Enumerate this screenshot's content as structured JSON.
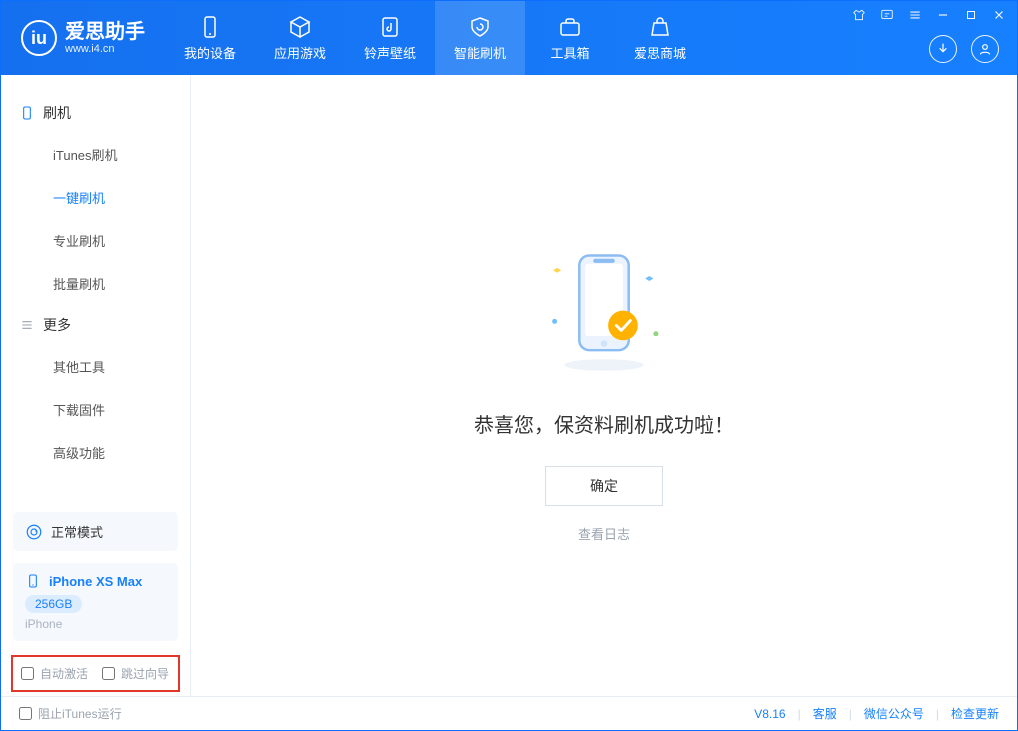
{
  "header": {
    "logo_title": "爱思助手",
    "logo_sub": "www.i4.cn",
    "nav": [
      {
        "label": "我的设备"
      },
      {
        "label": "应用游戏"
      },
      {
        "label": "铃声壁纸"
      },
      {
        "label": "智能刷机"
      },
      {
        "label": "工具箱"
      },
      {
        "label": "爱思商城"
      }
    ]
  },
  "sidebar": {
    "section1_title": "刷机",
    "section1_items": [
      {
        "label": "iTunes刷机"
      },
      {
        "label": "一键刷机"
      },
      {
        "label": "专业刷机"
      },
      {
        "label": "批量刷机"
      }
    ],
    "section2_title": "更多",
    "section2_items": [
      {
        "label": "其他工具"
      },
      {
        "label": "下载固件"
      },
      {
        "label": "高级功能"
      }
    ],
    "mode_label": "正常模式",
    "device_name": "iPhone XS Max",
    "device_storage": "256GB",
    "device_type": "iPhone",
    "chk_auto_activate": "自动激活",
    "chk_skip_guide": "跳过向导"
  },
  "main": {
    "message": "恭喜您，保资料刷机成功啦！",
    "ok_button": "确定",
    "view_log": "查看日志"
  },
  "footer": {
    "block_itunes": "阻止iTunes运行",
    "version": "V8.16",
    "links": [
      "客服",
      "微信公众号",
      "检查更新"
    ]
  }
}
